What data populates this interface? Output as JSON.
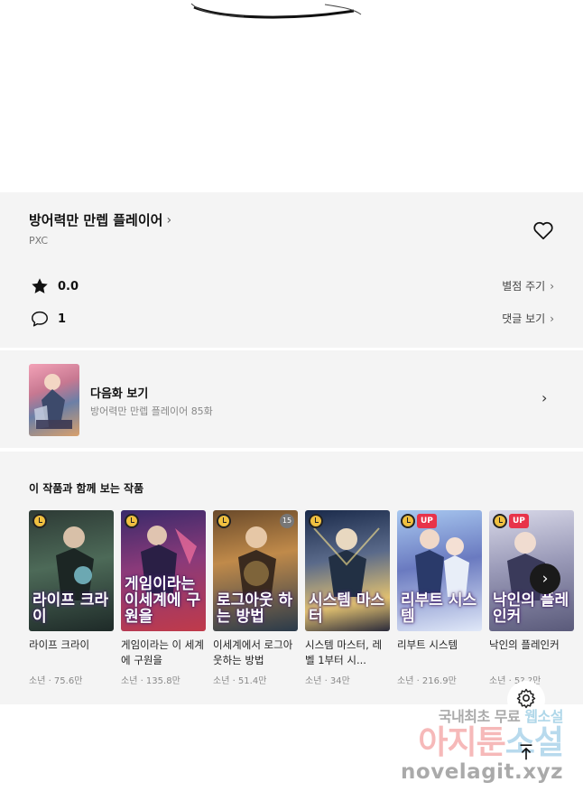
{
  "work": {
    "title": "방어력만 만렙 플레이어",
    "title_chevron": "›",
    "author": "PXC"
  },
  "stats": {
    "rating_value": "0.0",
    "rating_action": "별점 주기",
    "comment_count": "1",
    "comment_action": "댓글 보기",
    "chevron": "›"
  },
  "next_episode": {
    "label": "다음화 보기",
    "subtitle": "방어력만 만렙 플레이어 85화",
    "chevron": "›"
  },
  "recommendations": {
    "title": "이 작품과 함께 보는 작품",
    "items": [
      {
        "title": "라이프 크라이",
        "meta": "소년 · 75.6만",
        "cover_text": "라이프 크라이",
        "up": "",
        "age": ""
      },
      {
        "title": "게임이라는 이 세계에 구원을",
        "meta": "소년 · 135.8만",
        "cover_text": "게임이라는 이세계에 구원을",
        "up": "",
        "age": ""
      },
      {
        "title": "이세계에서 로그아웃하는 방법",
        "meta": "소년 · 51.4만",
        "cover_text": "로그아웃 하는 방법",
        "up": "",
        "age": "15"
      },
      {
        "title": "시스템 마스터, 레벨 1부터 시...",
        "meta": "소년 · 34만",
        "cover_text": "시스템 마스터",
        "up": "",
        "age": ""
      },
      {
        "title": "리부트 시스템",
        "meta": "소년 · 216.9만",
        "cover_text": "리부트 시스템",
        "up": "UP",
        "age": ""
      },
      {
        "title": "낙인의 플레인커",
        "meta": "소년 · 5?.?만",
        "cover_text": "낙인의 플레인커",
        "up": "UP",
        "age": ""
      }
    ],
    "next_arrow": "›"
  },
  "watermark": {
    "line1_a": "국내최초 무료",
    "line1_b": "웹소설",
    "line2_a": "아지툰",
    "line2_b": "소설",
    "line3": "novelagit.xyz"
  },
  "colors": {
    "section_bg": "#f4f4f4",
    "up_badge": "#e8334a",
    "clock_badge": "#f0c040"
  },
  "icons": {
    "heart": "heart-outline-icon",
    "star": "star-filled-icon",
    "comment": "speech-bubble-icon",
    "settings": "gear-icon",
    "scroll_top": "arrow-up-to-top-icon"
  }
}
